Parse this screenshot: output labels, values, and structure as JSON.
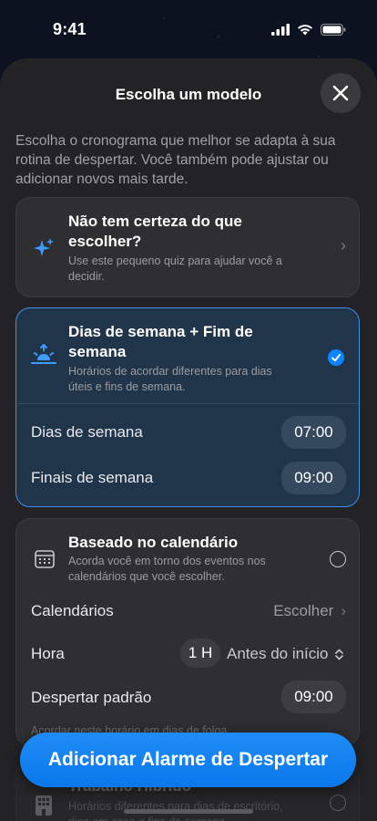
{
  "status": {
    "time": "9:41"
  },
  "sheet": {
    "title": "Escolha um modelo",
    "intro": "Escolha o cronograma que melhor se adapta à sua rotina de despertar. Você também pode ajustar ou adicionar novos mais tarde."
  },
  "quiz_card": {
    "title": "Não tem certeza do que escolher?",
    "subtitle": "Use este pequeno quiz para ajudar você a decidir.",
    "icon": "sparkles-icon"
  },
  "weekday_card": {
    "title": "Dias de semana + Fim de semana",
    "subtitle": "Horários de acordar diferentes para dias úteis e fins de semana.",
    "icon": "sunrise-icon",
    "rows": [
      {
        "label": "Dias de semana",
        "value": "07:00"
      },
      {
        "label": "Finais de semana",
        "value": "09:00"
      }
    ]
  },
  "calendar_card": {
    "title": "Baseado no calendário",
    "subtitle": "Acorda você em torno dos eventos nos calendários que você escolher.",
    "icon": "calendar-icon",
    "calendars_label": "Calendários",
    "calendars_value": "Escolher",
    "time_label": "Hora",
    "time_amount": "1 H",
    "time_relation": "Antes do início",
    "default_label": "Despertar padrão",
    "default_value": "09:00",
    "note": "Acordar neste horário em dias de folga."
  },
  "hybrid_card": {
    "title": "Trabalho Híbrido",
    "subtitle": "Horários diferentes para dias de escritório, dias em casa e fins de semana.",
    "icon": "building-icon"
  },
  "cta": {
    "label": "Adicionar Alarme de Despertar"
  },
  "colors": {
    "accent": "#0a84ff",
    "sheet": "#232325",
    "selected": "#21354a"
  }
}
